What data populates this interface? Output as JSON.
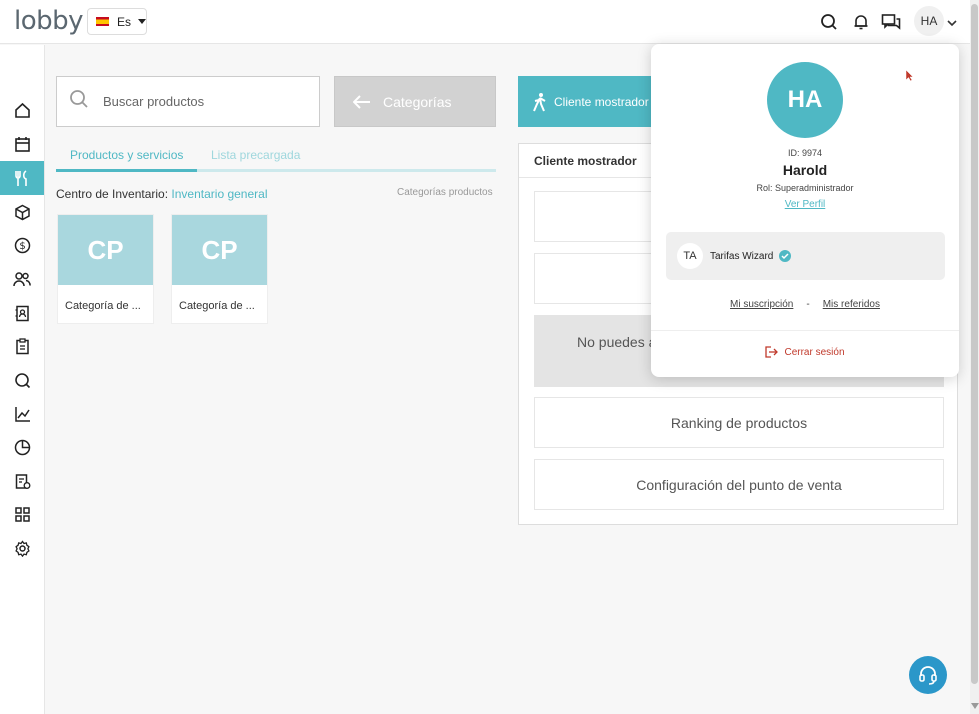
{
  "header": {
    "logo": "lobby",
    "language": "Es",
    "user_initials": "HA"
  },
  "sidebar": {
    "items": [
      {
        "icon": "home-icon"
      },
      {
        "icon": "calendar-icon"
      },
      {
        "icon": "utensils-icon",
        "active": true
      },
      {
        "icon": "box-icon"
      },
      {
        "icon": "dollar-icon"
      },
      {
        "icon": "users-icon"
      },
      {
        "icon": "contacts-book-icon"
      },
      {
        "icon": "clipboard-icon"
      },
      {
        "icon": "search-icon"
      },
      {
        "icon": "line-chart-icon"
      },
      {
        "icon": "pie-chart-icon"
      },
      {
        "icon": "report-badge-icon"
      },
      {
        "icon": "grid-icon"
      },
      {
        "icon": "settings-icon"
      }
    ]
  },
  "main": {
    "search_placeholder": "Buscar productos",
    "categories_button": "Categorías",
    "cliente_button": "Cliente mostrador",
    "tabs": [
      {
        "label": "Productos y servicios",
        "active": true
      },
      {
        "label": "Lista precargada",
        "active": false
      }
    ],
    "inventory_label": "Centro de Inventario:",
    "inventory_value": "Inventario general",
    "categories_products": "Categorías productos",
    "cards": [
      {
        "initials": "CP",
        "name": "Categoría de ..."
      },
      {
        "initials": "CP",
        "name": "Categoría de ..."
      }
    ]
  },
  "panel": {
    "title": "Cliente mostrador",
    "notice": "No puedes ag",
    "ranking": "Ranking de productos",
    "config": "Configuración del punto de venta"
  },
  "profile": {
    "initials": "HA",
    "id": "ID: 9974",
    "name": "Harold",
    "role": "Rol: Superadministrador",
    "view_profile": "Ver Perfil",
    "account_initials": "TA",
    "account_name": "Tarifas Wizard",
    "subscription": "Mi suscripción",
    "separator": "-",
    "referrals": "Mis referidos",
    "logout": "Cerrar sesión"
  },
  "colors": {
    "accent": "#4fb8c4",
    "help": "#2b97c9",
    "logout": "#c0392b"
  }
}
